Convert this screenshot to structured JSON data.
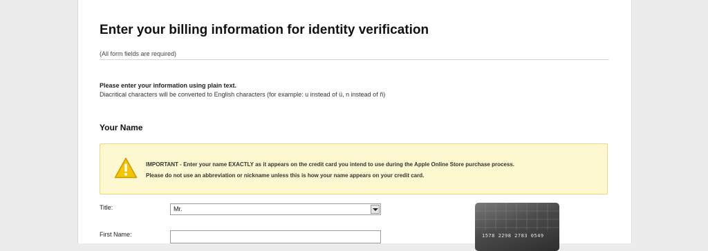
{
  "page": {
    "title": "Enter your billing information for identity verification",
    "required_note": "(All form fields are required)"
  },
  "plain_text": {
    "title": "Please enter your information using plain text.",
    "description": "Diacritical characters will be converted to English characters (for example: u instead of ü, n instead of ñ)"
  },
  "name_section": {
    "heading": "Your Name",
    "alert": {
      "icon": "warning-icon",
      "line1": "IMPORTANT - Enter your name EXACTLY as it appears on the credit card you intend to use during the Apple Online Store purchase process.",
      "line2": "Please do not use an abbreviation or nickname unless this is how your name appears on your credit card.",
      "background": "#fdf8cf",
      "border": "#e9d97a"
    },
    "title_field": {
      "label": "Title:",
      "selected": "Mr."
    },
    "first_name_field": {
      "label": "First Name:",
      "value": ""
    }
  },
  "card_image": {
    "number": "1578 2298 2783 0549"
  }
}
